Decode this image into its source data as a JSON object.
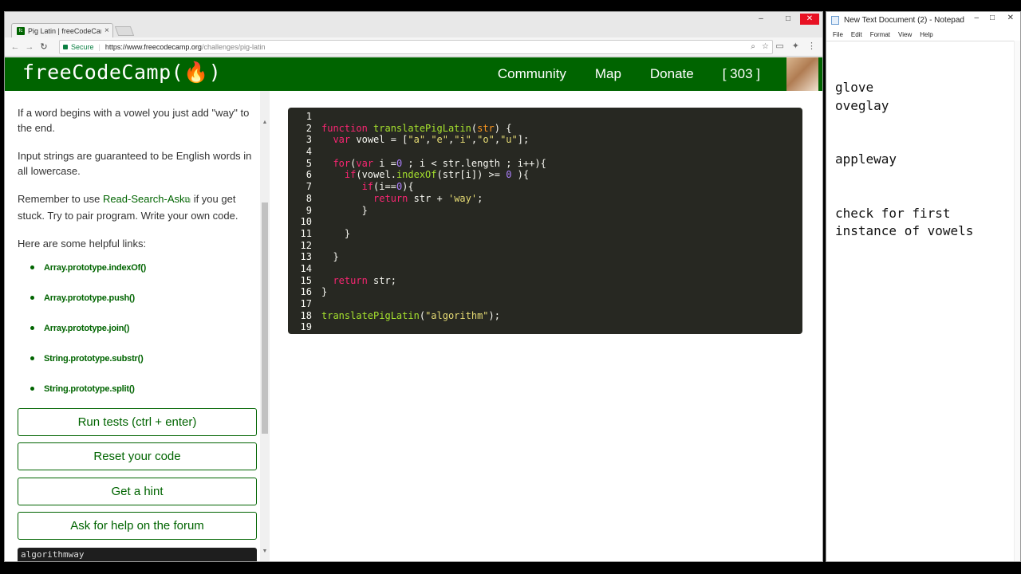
{
  "browser": {
    "tab_title": "Pig Latin | freeCodeCamp",
    "tab_close": "×",
    "secure_label": "Secure",
    "url_host": "https://www.freecodecamp.org",
    "url_path": "/challenges/pig-latin",
    "min_glyph": "–",
    "max_glyph": "□",
    "close_glyph": "✕"
  },
  "navbar": {
    "logo": "freeCodeCamp(🔥)",
    "community": "Community",
    "map": "Map",
    "donate": "Donate",
    "points": "[ 303 ]"
  },
  "instructions": {
    "p1": "If a word begins with a vowel you just add \"way\" to the end.",
    "p2": "Input strings are guaranteed to be English words in all lowercase.",
    "p3_before": "Remember to use ",
    "p3_link": "Read-Search-Ask",
    "p3_after": "if you get stuck. Try to pair program. Write your own code.",
    "helpful": "Here are some helpful links:",
    "links": [
      "Array.prototype.indexOf()",
      "Array.prototype.push()",
      "Array.prototype.join()",
      "String.prototype.substr()",
      "String.prototype.split()"
    ]
  },
  "buttons": {
    "run": "Run tests (ctrl + enter)",
    "reset": "Reset your code",
    "hint": "Get a hint",
    "forum": "Ask for help on the forum"
  },
  "output_text": "algorithmway",
  "editor": {
    "line_numbers": [
      "1",
      "2",
      "3",
      "4",
      "5",
      "6",
      "7",
      "8",
      "9",
      "10",
      "11",
      "12",
      "13",
      "14",
      "15",
      "16",
      "17",
      "18",
      "19"
    ]
  },
  "notepad": {
    "title": "New Text Document (2) - Notepad",
    "menu": [
      "File",
      "Edit",
      "Format",
      "View",
      "Help"
    ],
    "text": "glove\noveglay\n\n\nappleway\n\n\ncheck for first\ninstance of vowels"
  }
}
